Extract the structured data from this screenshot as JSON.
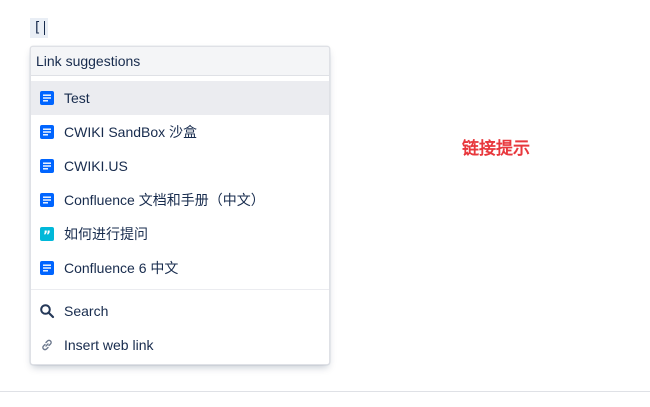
{
  "editor": {
    "typed_text": "["
  },
  "popup": {
    "header": "Link suggestions",
    "items": [
      {
        "label": "Test",
        "icon": "page-icon",
        "icon_color": "#0052cc"
      },
      {
        "label": "CWIKI SandBox 沙盒",
        "icon": "page-icon",
        "icon_color": "#0052cc"
      },
      {
        "label": "CWIKI.US",
        "icon": "page-icon",
        "icon_color": "#0052cc"
      },
      {
        "label": "Confluence 文档和手册（中文）",
        "icon": "page-icon",
        "icon_color": "#0052cc"
      },
      {
        "label": "如何进行提问",
        "icon": "quote-icon",
        "icon_color": "#00b8d9"
      },
      {
        "label": "Confluence 6 中文",
        "icon": "page-icon",
        "icon_color": "#0052cc"
      }
    ],
    "selected_item": "Test",
    "actions": [
      {
        "label": "Search",
        "icon": "search-icon"
      },
      {
        "label": "Insert web link",
        "icon": "link-icon"
      }
    ]
  },
  "annotation": {
    "text": "链接提示",
    "color": "#e8383d"
  }
}
